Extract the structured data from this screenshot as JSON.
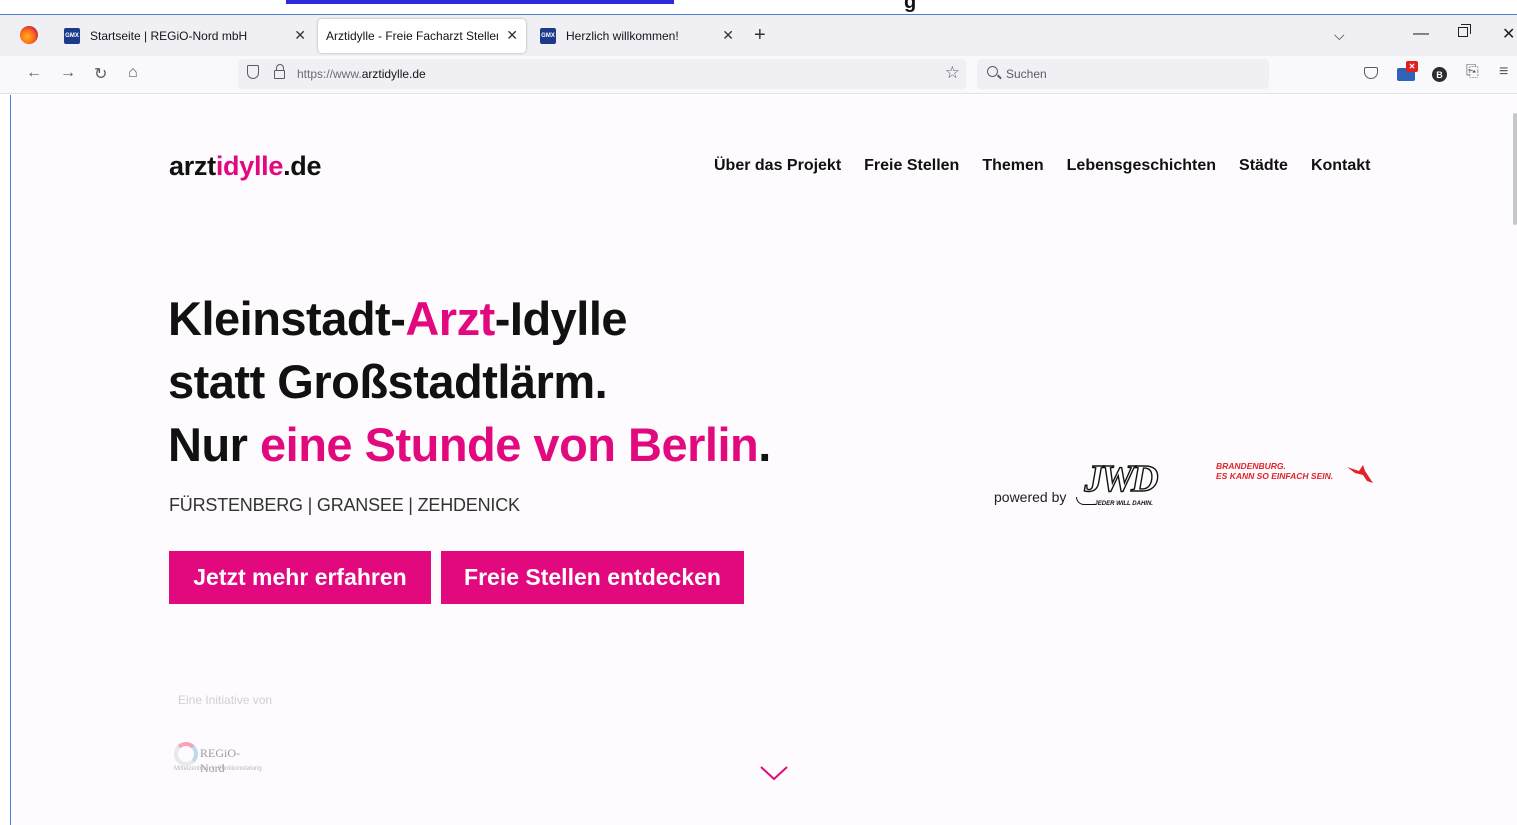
{
  "browser": {
    "tabs": [
      {
        "title": "Startseite | REGiO-Nord mbH",
        "favicon": "GMX",
        "active": false
      },
      {
        "title": "Arztidylle - Freie Facharzt Stellen ein",
        "active": true
      },
      {
        "title": "Herzlich willkommen!",
        "favicon": "GMX",
        "active": false
      }
    ],
    "url_protocol": "https://www.",
    "url_domain": "arztidylle.de",
    "search_placeholder": "Suchen",
    "bitwarden_letter": "B",
    "top_fragment": "g"
  },
  "site": {
    "logo_part1": "arzt",
    "logo_part2": "idylle",
    "logo_part3": ".de",
    "nav": [
      "Über das Projekt",
      "Freie Stellen",
      "Themen",
      "Lebensgeschichten",
      "Städte",
      "Kontakt"
    ],
    "hero": {
      "line1_a": "Kleinstadt-",
      "line1_b": "Arzt",
      "line1_c": "-Idylle",
      "line2": "statt Großstadtlärm.",
      "line3_a": "Nur ",
      "line3_b": "eine Stunde von Berlin",
      "line3_c": "."
    },
    "cities": "FÜRSTENBERG | GRANSEE | ZEHDENICK",
    "btn_more": "Jetzt mehr erfahren",
    "btn_jobs": "Freie Stellen entdecken",
    "powered_by": "powered by",
    "jwd_logo": "JWD",
    "jwd_tagline": "JEDER WILL DAHIN.",
    "brandenburg_line1": "BRANDENBURG.",
    "brandenburg_line2": "ES KANN SO EINFACH SEIN.",
    "initiative_label": "Eine Initiative von",
    "regio_name": "REGiO-Nord",
    "regio_sub": "Mittelzentrum in Funktionsteilung"
  },
  "colors": {
    "accent": "#e2097f",
    "brandenburg_red": "#e0232a"
  }
}
